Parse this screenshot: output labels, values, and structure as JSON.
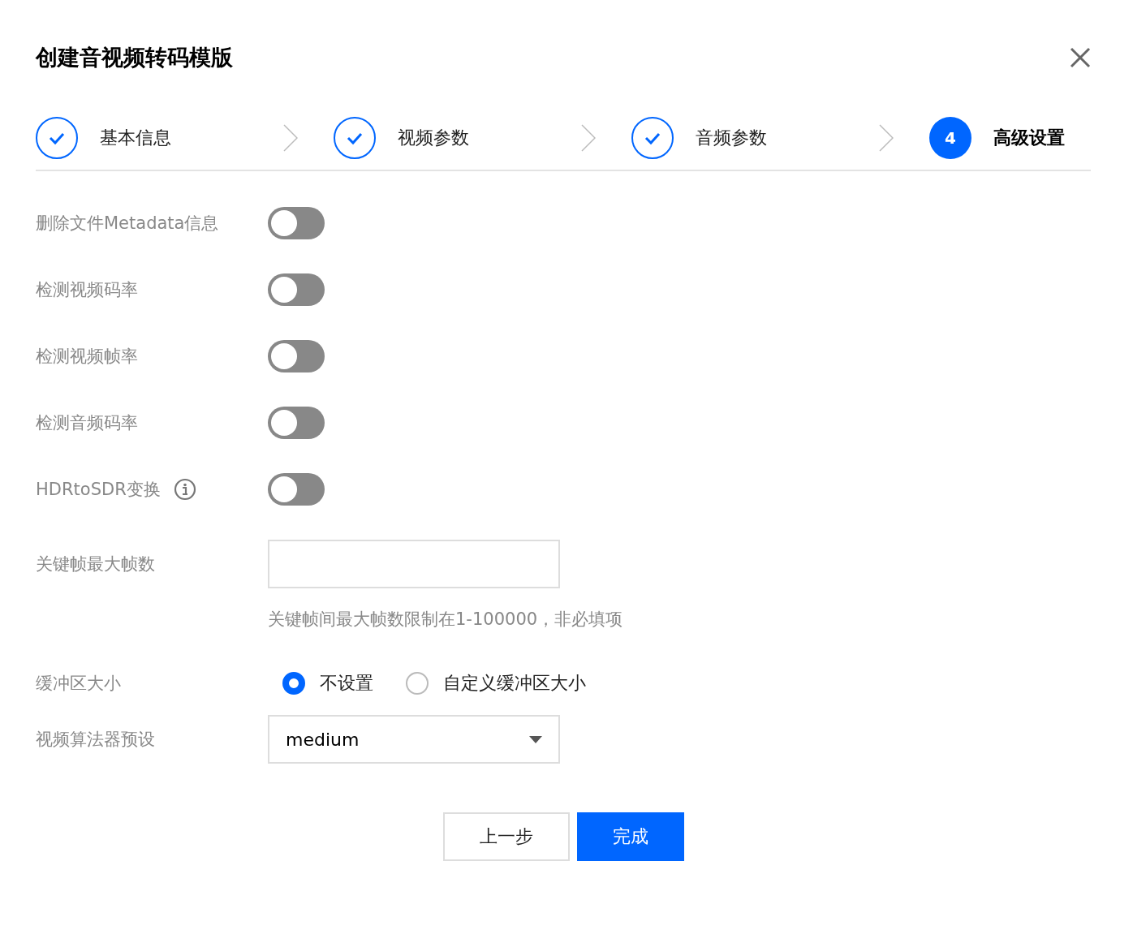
{
  "dialog": {
    "title": "创建音视频转码模版"
  },
  "steps": [
    {
      "label": "基本信息",
      "done": true,
      "selected": false
    },
    {
      "label": "视频参数",
      "done": true,
      "selected": false
    },
    {
      "label": "音频参数",
      "done": true,
      "selected": false
    },
    {
      "label": "高级设置",
      "done": false,
      "selected": true,
      "number": "4"
    }
  ],
  "form": [
    {
      "kind": "toggle",
      "label": "删除文件Metadata信息",
      "on": false
    },
    {
      "kind": "toggle",
      "label": "检测视频码率",
      "on": false
    },
    {
      "kind": "toggle",
      "label": "检测视频帧率",
      "on": false
    },
    {
      "kind": "toggle",
      "label": "检测音频码率",
      "on": false
    },
    {
      "kind": "toggle",
      "label": "HDRtoSDR变换",
      "on": false,
      "info": true
    },
    {
      "kind": "input",
      "label": "关键帧最大帧数",
      "hint": "关键帧间最大帧数限制在1-100000，非必填项"
    },
    {
      "kind": "radio",
      "label": "缓冲区大小",
      "options": [
        {
          "label": "不设置",
          "selected": true
        },
        {
          "label": "自定义缓冲区大小",
          "selected": false
        }
      ]
    },
    {
      "kind": "select",
      "label": "视频算法器预设",
      "value": "medium"
    }
  ],
  "buttons": [
    {
      "label": "上一步",
      "kind": "secondary"
    },
    {
      "label": "完成",
      "kind": "primary"
    }
  ]
}
